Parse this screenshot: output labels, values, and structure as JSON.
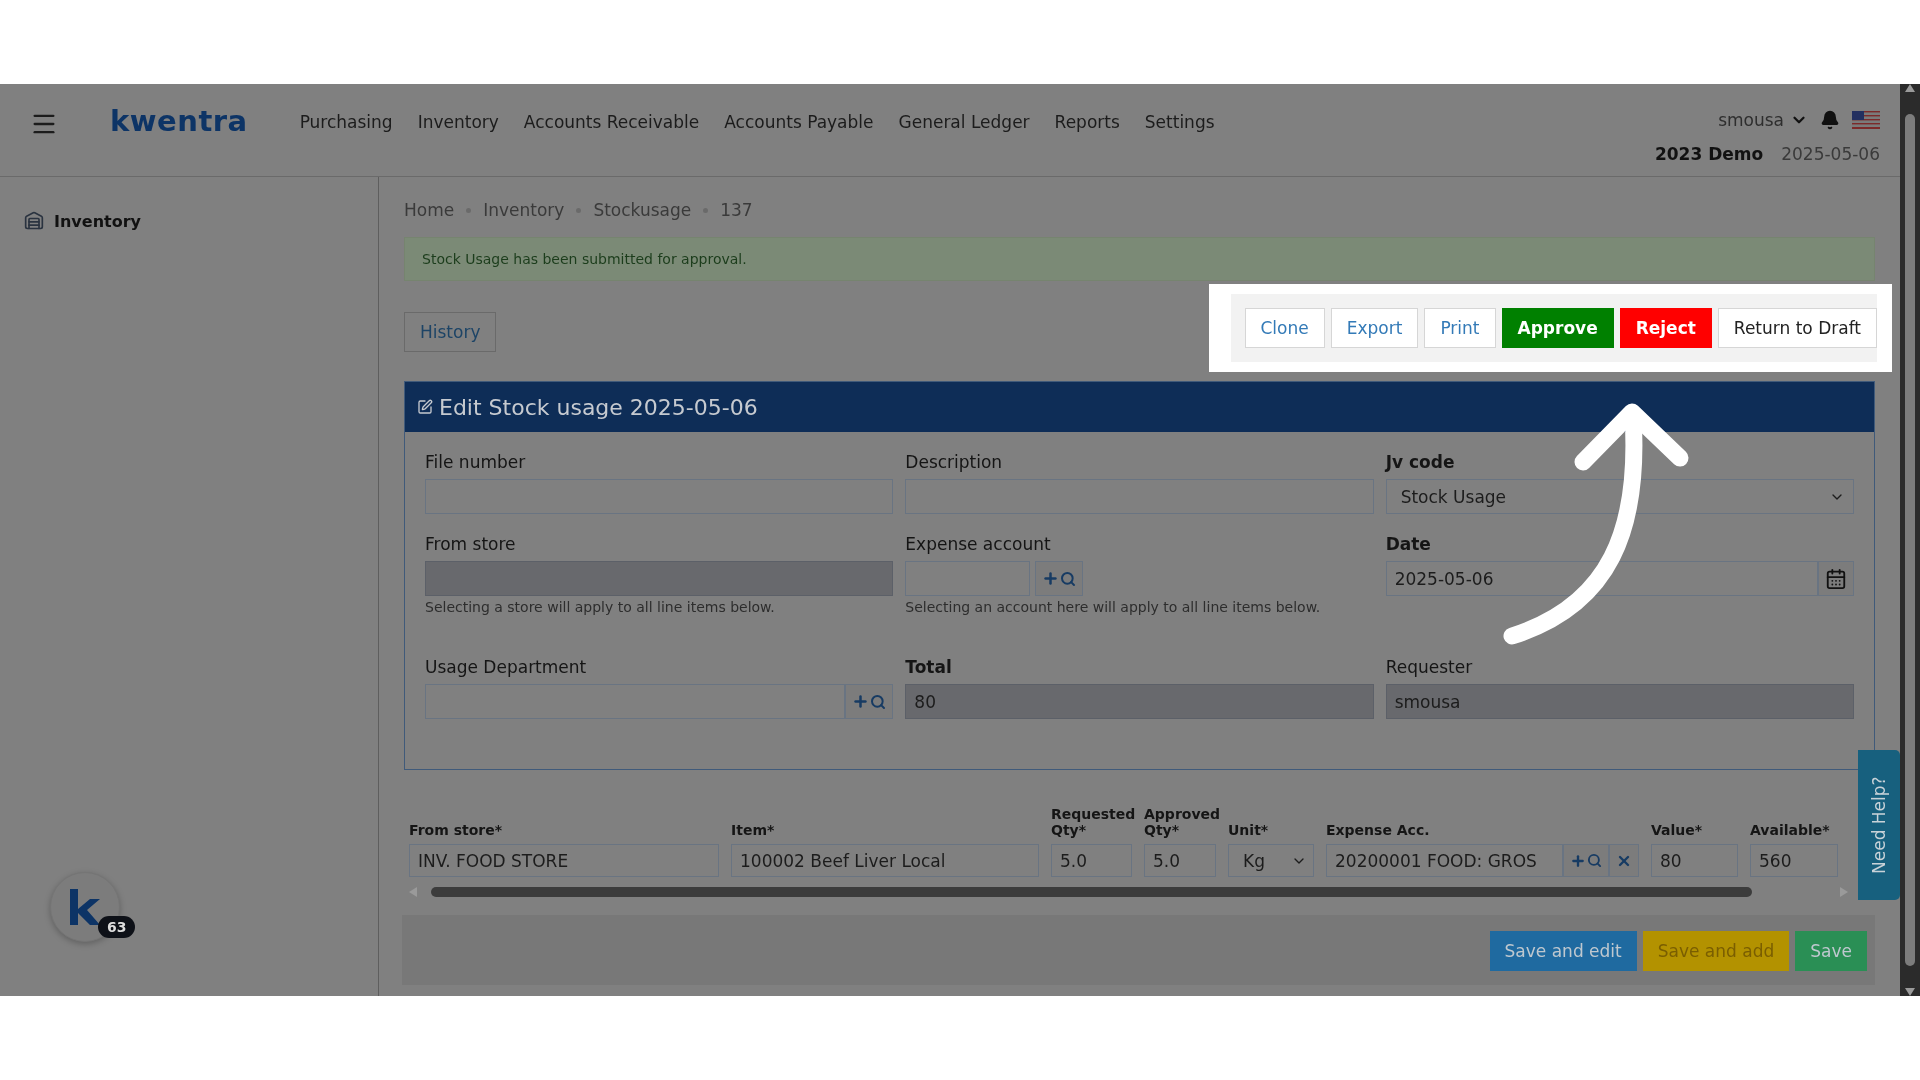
{
  "nav": {
    "logo": "kwentra",
    "menu": [
      "Purchasing",
      "Inventory",
      "Accounts Receivable",
      "Accounts Payable",
      "General Ledger",
      "Reports",
      "Settings"
    ],
    "user": "smousa",
    "company": "2023 Demo",
    "date": "2025-05-06"
  },
  "sidebar": {
    "items": [
      {
        "label": "Inventory"
      }
    ]
  },
  "launcher": {
    "badge": "63"
  },
  "breadcrumb": [
    "Home",
    "Inventory",
    "Stockusage",
    "137"
  ],
  "alert": "Stock Usage has been submitted for approval.",
  "history_button": "History",
  "actions": [
    {
      "label": "Clone",
      "kind": "default"
    },
    {
      "label": "Export",
      "kind": "default"
    },
    {
      "label": "Print",
      "kind": "default"
    },
    {
      "label": "Approve",
      "kind": "success"
    },
    {
      "label": "Reject",
      "kind": "danger"
    },
    {
      "label": "Return to Draft",
      "kind": "plain"
    }
  ],
  "panel": {
    "title": "Edit Stock usage 2025-05-06",
    "fields": [
      {
        "label": "File number",
        "kind": "text",
        "emphasis": false,
        "disabled": false
      },
      {
        "label": "Description",
        "kind": "text",
        "emphasis": false,
        "disabled": false
      },
      {
        "label": "Jv code",
        "kind": "select",
        "value": "Stock Usage",
        "emphasis": true,
        "disabled": false
      },
      {
        "label": "From store",
        "kind": "text",
        "emphasis": false,
        "disabled": true,
        "help": "Selecting a store will apply to all line items below."
      },
      {
        "label": "Expense account",
        "kind": "lookup",
        "wide": false,
        "emphasis": false,
        "disabled": false,
        "help": "Selecting an account here will apply to all line items below."
      },
      {
        "label": "Date",
        "kind": "date",
        "value": "2025-05-06",
        "emphasis": true,
        "disabled": false
      },
      {
        "label": "Usage Department",
        "kind": "lookup",
        "wide": true,
        "emphasis": false,
        "disabled": false
      },
      {
        "label": "Total",
        "kind": "text",
        "value": "80",
        "emphasis": true,
        "disabled": true
      },
      {
        "label": "Requester",
        "kind": "text",
        "value": "smousa",
        "emphasis": false,
        "disabled": true
      }
    ]
  },
  "lines": {
    "columns": [
      "From store*",
      "Item*",
      "Requested Qty*",
      "Approved Qty*",
      "Unit*",
      "Expense Acc.",
      "Value*",
      "Available*"
    ],
    "rows": [
      {
        "cells": [
          {
            "kind": "text",
            "value": "INV. FOOD STORE"
          },
          {
            "kind": "text",
            "value": "100002 Beef Liver Local"
          },
          {
            "kind": "text",
            "value": "5.0"
          },
          {
            "kind": "text",
            "value": "5.0"
          },
          {
            "kind": "select",
            "value": "Kg"
          },
          {
            "kind": "account",
            "value": "20200001 FOOD: GROS"
          },
          {
            "kind": "text",
            "value": "80"
          },
          {
            "kind": "text",
            "value": "560"
          }
        ]
      }
    ]
  },
  "footer_buttons": [
    {
      "label": "Save and edit",
      "kind": "primary"
    },
    {
      "label": "Save and add",
      "kind": "warning"
    },
    {
      "label": "Save",
      "kind": "success"
    }
  ],
  "help_tab": "Need Help?"
}
